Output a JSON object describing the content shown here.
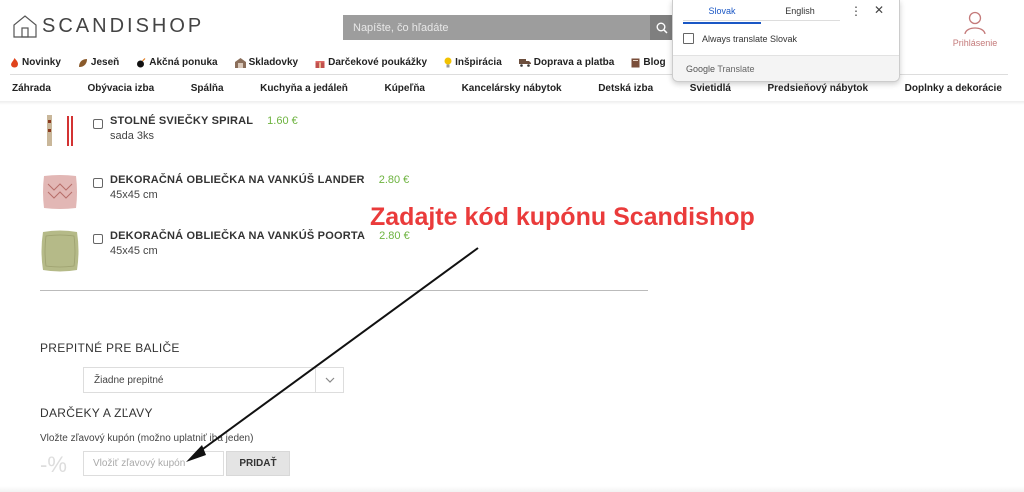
{
  "header": {
    "logo_text_1": "SCANDI",
    "logo_text_2": "SHOP",
    "search_placeholder": "Napíšte, čo hľadáte",
    "login_label": "Prihlásenie"
  },
  "nav_primary": [
    {
      "label": "Novinky",
      "icon": "flame-icon",
      "color": "#e0431c"
    },
    {
      "label": "Jeseň",
      "icon": "leaf-icon",
      "color": "#8a5a2b"
    },
    {
      "label": "Akčná ponuka",
      "icon": "bomb-icon",
      "color": "#111111"
    },
    {
      "label": "Skladovky",
      "icon": "warehouse-icon",
      "color": "#8a6e5a"
    },
    {
      "label": "Darčekové poukážky",
      "icon": "gift-icon",
      "color": "#c0504d"
    },
    {
      "label": "Inšpirácia",
      "icon": "bulb-icon",
      "color": "#f2c200"
    },
    {
      "label": "Doprava a platba",
      "icon": "truck-icon",
      "color": "#6b4e3d"
    },
    {
      "label": "Blog",
      "icon": "book-icon",
      "color": "#7a4e3a"
    }
  ],
  "nav_categories": [
    "Záhrada",
    "Obývacia izba",
    "Spálňa",
    "Kuchyňa a jedáleň",
    "Kúpeľňa",
    "Kancelársky nábytok",
    "Detská izba",
    "Svietidlá",
    "Predsieňový nábytok",
    "Doplnky a dekorácie"
  ],
  "products": [
    {
      "name": "STOLNÉ SVIEČKY SPIRAL",
      "price": "1.60 €",
      "desc": "sada 3ks"
    },
    {
      "name": "DEKORAČNÁ OBLIEČKA NA VANKÚŠ LANDER",
      "price": "2.80 €",
      "desc": "45x45 cm"
    },
    {
      "name": "DEKORAČNÁ OBLIEČKA NA VANKÚŠ POORTA",
      "price": "2.80 €",
      "desc": "45x45 cm"
    }
  ],
  "tips": {
    "title": "PREPITNÉ PRE BALIČE",
    "selected": "Žiadne prepitné"
  },
  "discounts": {
    "title": "DARČEKY A ZĽAVY",
    "label": "Vložte zľavový kupón (možno uplatniť iba jeden)",
    "percent_symbol": "-%",
    "placeholder": "Vložiť zľavový kupón",
    "button": "PRIDAŤ"
  },
  "annotation": "Zadajte kód kupónu Scandishop",
  "translate_popup": {
    "tab_source": "Slovak",
    "tab_target": "English",
    "more": "⋮",
    "close": "✕",
    "always_translate": "Always translate Slovak",
    "footer_brand": "Google",
    "footer_product": "Translate"
  },
  "colors": {
    "price_green": "#6db33f",
    "annotation_red": "#ea3b3b",
    "login_pink": "#c47a7a",
    "translate_blue": "#1a57c5"
  }
}
